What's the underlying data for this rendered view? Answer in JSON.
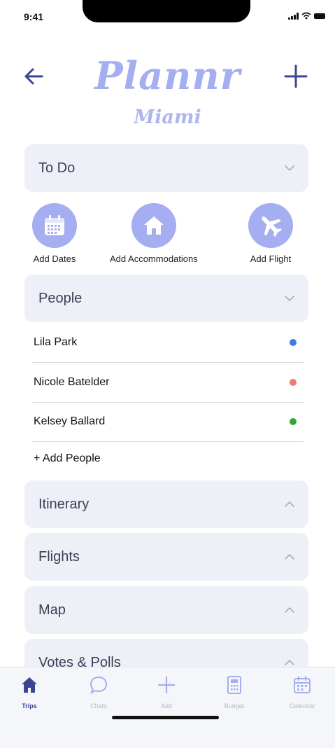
{
  "status_bar": {
    "time": "9:41"
  },
  "header": {
    "title": "Plannr",
    "city": "Miami"
  },
  "sections": {
    "todo": "To Do",
    "people": "People",
    "itinerary": "Itinerary",
    "flights": "Flights",
    "map": "Map",
    "votes": "Votes & Polls"
  },
  "todo_actions": [
    {
      "label": "Add Dates",
      "icon": "calendar-icon"
    },
    {
      "label": "Add Accommodations",
      "icon": "house-icon"
    },
    {
      "label": "Add Flight",
      "icon": "airplane-icon"
    }
  ],
  "people": [
    {
      "name": "Lila Park",
      "color": "#3d7be8"
    },
    {
      "name": "Nicole Batelder",
      "color": "#ec7b73"
    },
    {
      "name": "Kelsey Ballard",
      "color": "#30a83a"
    }
  ],
  "add_people": "+ Add People",
  "tabs": [
    {
      "label": "Trips",
      "icon": "house-icon",
      "active": true
    },
    {
      "label": "Chats",
      "icon": "chat-bubble-icon",
      "active": false
    },
    {
      "label": "Add",
      "icon": "plus-icon",
      "active": false
    },
    {
      "label": "Budget",
      "icon": "calculator-icon",
      "active": false
    },
    {
      "label": "Calendar",
      "icon": "calendar-icon",
      "active": false
    }
  ],
  "colors": {
    "accent": "#a4aef0",
    "nav": "#3c4594",
    "section_bg": "#eef0f8"
  }
}
